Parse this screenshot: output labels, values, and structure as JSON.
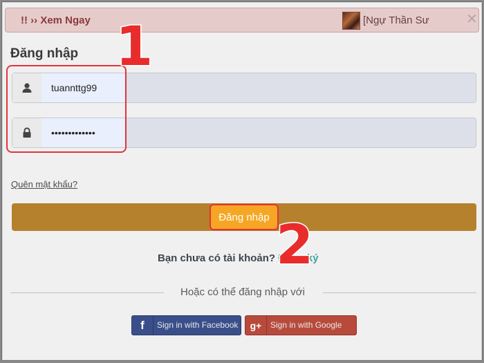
{
  "banner": {
    "text": "!! ›› Xem Ngay",
    "link_text": "[Ngự Thần Sư",
    "close_symbol": "✕"
  },
  "login": {
    "title": "Đăng nhập",
    "username_value": "tuannttg99",
    "password_value": "•••••••••••••",
    "forgot_link": "Quên mật khẩu?",
    "submit_label": "Đăng nhập"
  },
  "signup": {
    "prompt": "Bạn chưa có tài khoản?",
    "link": "Đăng ký"
  },
  "social": {
    "divider_text": "Hoặc có thể đăng nhập với",
    "facebook_label": "Sign in with Facebook",
    "facebook_glyph": "f",
    "google_label": "Sign in with Google",
    "google_glyph": "g+"
  },
  "annotations": {
    "step1": "1",
    "step2": "2"
  },
  "icons": {
    "username": "user-icon",
    "password": "lock-icon"
  },
  "colors": {
    "submit_button": "#f5a623",
    "highlight_box": "#e2333a",
    "signup_link": "#3aa7a0",
    "facebook": "#3a4f8a",
    "google": "#b84a3c"
  }
}
